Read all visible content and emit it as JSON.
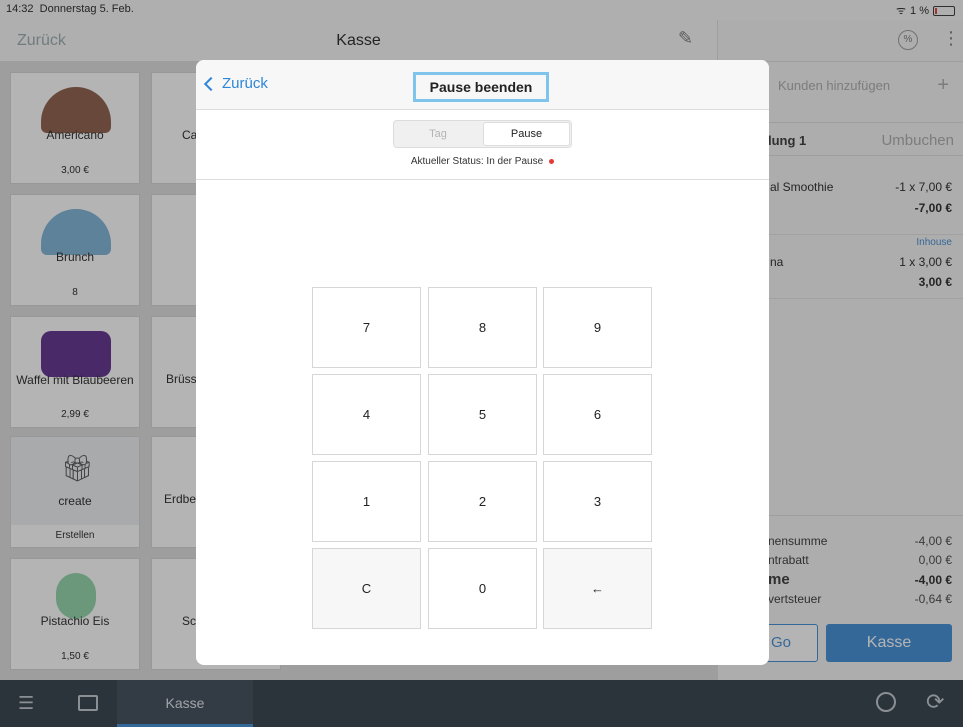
{
  "status_bar": {
    "time": "14:32",
    "date": "Donnerstag 5. Feb.",
    "battery": "1 %"
  },
  "header": {
    "back": "Zurück",
    "title": "Kasse"
  },
  "tiles": [
    {
      "name": "Americano",
      "price": "3,00 €"
    },
    {
      "name": "Ca",
      "price": ""
    },
    {
      "name": "Brunch",
      "price": "8"
    },
    {
      "name": "Waffel mit Blaubeeren",
      "price": "2,99 €"
    },
    {
      "name": "Brüss",
      "price": ""
    },
    {
      "name": "create",
      "price": "Erstellen"
    },
    {
      "name": "Erdbe",
      "price": ""
    },
    {
      "name": "Pistachio Eis",
      "price": "1,50 €"
    },
    {
      "name": "Sc",
      "price": ""
    }
  ],
  "right_panel": {
    "customer_placeholder": "Kunden hinzufügen",
    "order_label": "lung 1",
    "rebook": "Umbuchen",
    "items": [
      {
        "name": "al Smoothie",
        "qty": "-1 x 7,00 €",
        "total": "-7,00 €",
        "tag": ""
      },
      {
        "name": "na",
        "qty": "1 x 3,00 €",
        "total": "3,00 €",
        "tag": "Inhouse"
      }
    ],
    "totals": [
      {
        "label": "nensumme",
        "value": "-4,00 €"
      },
      {
        "label": "ntrabatt",
        "value": "0,00 €"
      },
      {
        "label": "me",
        "value": "-4,00 €"
      },
      {
        "label": "vertsteuer",
        "value": "-0,64 €"
      }
    ],
    "go_button": "Go",
    "checkout_button": "Kasse"
  },
  "bottom_bar": {
    "active_tab": "Kasse"
  },
  "modal": {
    "back": "Zurück",
    "title": "Pause beenden",
    "segments": [
      "Tag",
      "Pause"
    ],
    "status_text": "Aktueller Status: In der Pause",
    "keys": [
      "7",
      "8",
      "9",
      "4",
      "5",
      "6",
      "1",
      "2",
      "3",
      "C",
      "0",
      "←"
    ]
  }
}
